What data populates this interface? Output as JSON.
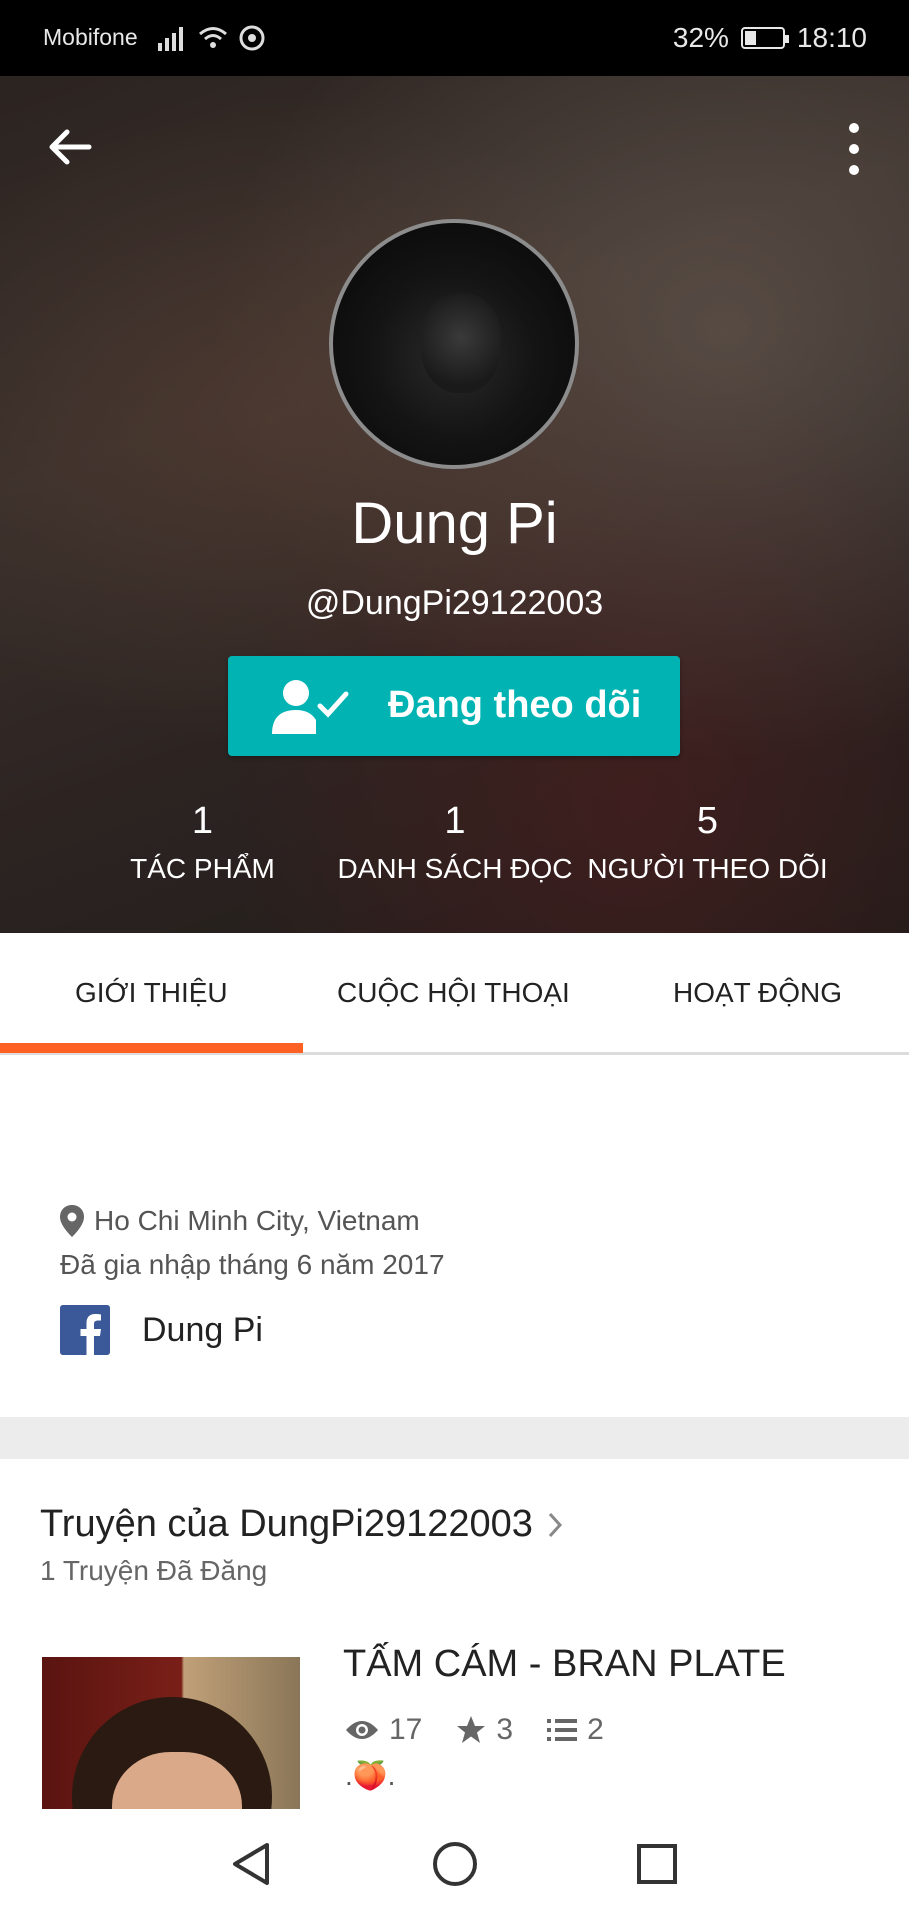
{
  "status_bar": {
    "carrier": "Mobifone",
    "battery": "32%",
    "battery_level": 0.32,
    "time": "18:10",
    "icons": [
      "signal-icon",
      "wifi-icon",
      "data-saver-icon"
    ]
  },
  "profile": {
    "display_name": "Dung Pi",
    "username": "@DungPi29122003",
    "follow_button": "Đang theo dõi",
    "stats": [
      {
        "value": "1",
        "label": "TÁC PHẨM"
      },
      {
        "value": "1",
        "label": "DANH SÁCH ĐỌC"
      },
      {
        "value": "5",
        "label": "NGƯỜI THEO DÕI"
      }
    ]
  },
  "tabs": [
    {
      "label": "GIỚI THIỆU",
      "active": true
    },
    {
      "label": "CUỘC HỘI THOẠI",
      "active": false
    },
    {
      "label": "HOẠT ĐỘNG",
      "active": false
    }
  ],
  "about": {
    "location": "Ho Chi Minh City, Vietnam",
    "joined": "Đã gia nhập tháng 6 năm 2017",
    "facebook_name": "Dung Pi"
  },
  "stories": {
    "title": "Truyện của DungPi29122003",
    "count": "1 Truyện Đã Đăng",
    "items": [
      {
        "title": "TẤM CÁM - BRAN PLATE",
        "views": "17",
        "votes": "3",
        "parts": "2",
        "tag": ".🍑."
      }
    ]
  },
  "colors": {
    "accent_orange": "#ff6122",
    "follow_teal": "#01b3b3",
    "facebook_blue": "#3b5998"
  }
}
